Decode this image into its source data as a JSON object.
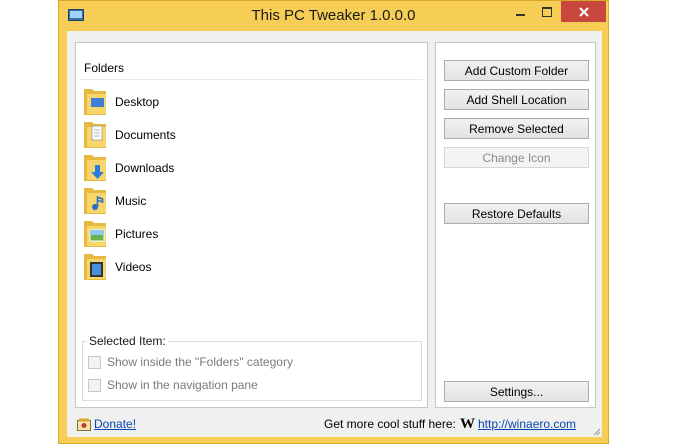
{
  "window": {
    "title": "This PC Tweaker 1.0.0.0",
    "frame_color": "#f6cd55",
    "close_color": "#c7463d"
  },
  "caption_buttons": {
    "minimize_icon": "minimize-icon",
    "maximize_icon": "maximize-icon",
    "close_icon": "close-icon"
  },
  "folders": {
    "header": "Folders",
    "items": [
      {
        "label": "Desktop",
        "icon": "desktop-folder-icon"
      },
      {
        "label": "Documents",
        "icon": "documents-folder-icon"
      },
      {
        "label": "Downloads",
        "icon": "downloads-folder-icon"
      },
      {
        "label": "Music",
        "icon": "music-folder-icon"
      },
      {
        "label": "Pictures",
        "icon": "pictures-folder-icon"
      },
      {
        "label": "Videos",
        "icon": "videos-folder-icon"
      }
    ]
  },
  "selected_item": {
    "title": "Selected Item:",
    "show_in_folders_label": "Show inside the \"Folders\" category",
    "show_in_nav_label": "Show in the navigation pane"
  },
  "actions": {
    "add_custom_folder": "Add Custom Folder",
    "add_shell_location": "Add Shell Location",
    "remove_selected": "Remove Selected",
    "change_icon": "Change Icon",
    "restore_defaults": "Restore Defaults",
    "settings": "Settings..."
  },
  "footer": {
    "donate": "Donate!",
    "promo": "Get more cool stuff here:",
    "logo_letter": "W",
    "site": "http://winaero.com"
  }
}
